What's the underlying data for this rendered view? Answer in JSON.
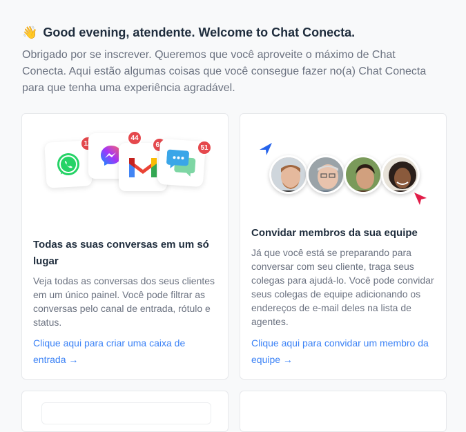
{
  "header": {
    "emoji": "👋",
    "greeting": "Good evening, atendente. Welcome to Chat Conecta.",
    "intro": "Obrigado por se inscrever. Queremos que você aproveite o máximo de Chat Conecta. Aqui estão algumas coisas que você consegue fazer no(a) Chat Conecta para que tenha uma experiência agradável."
  },
  "cards": [
    {
      "title": "Todas as suas conversas em um só lugar",
      "body": "Veja todas as conversas dos seus clientes em um único painel. Você pode filtrar as conversas pelo canal de entrada, rótulo e status.",
      "link": "Clique aqui para criar uma caixa de entrada →",
      "icons": [
        "whatsapp-icon",
        "messenger-icon",
        "gmail-icon",
        "chat-icon"
      ],
      "badges": [
        "12",
        "44",
        "61",
        "51"
      ]
    },
    {
      "title": "Convidar membros da sua equipe",
      "body": "Já que você está se preparando para conversar com seu cliente, traga seus colegas para ajudá-lo. Você pode convidar seus colegas de equipe adicionando os endereços de e-mail deles na lista de agentes.",
      "link": "Clique aqui para convidar um membro da equipe →"
    }
  ],
  "colors": {
    "link": "#3b82f6",
    "badge": "#e5484d",
    "whatsapp": "#25d366",
    "cursor_blue": "#2563eb",
    "cursor_red": "#e11d48"
  }
}
